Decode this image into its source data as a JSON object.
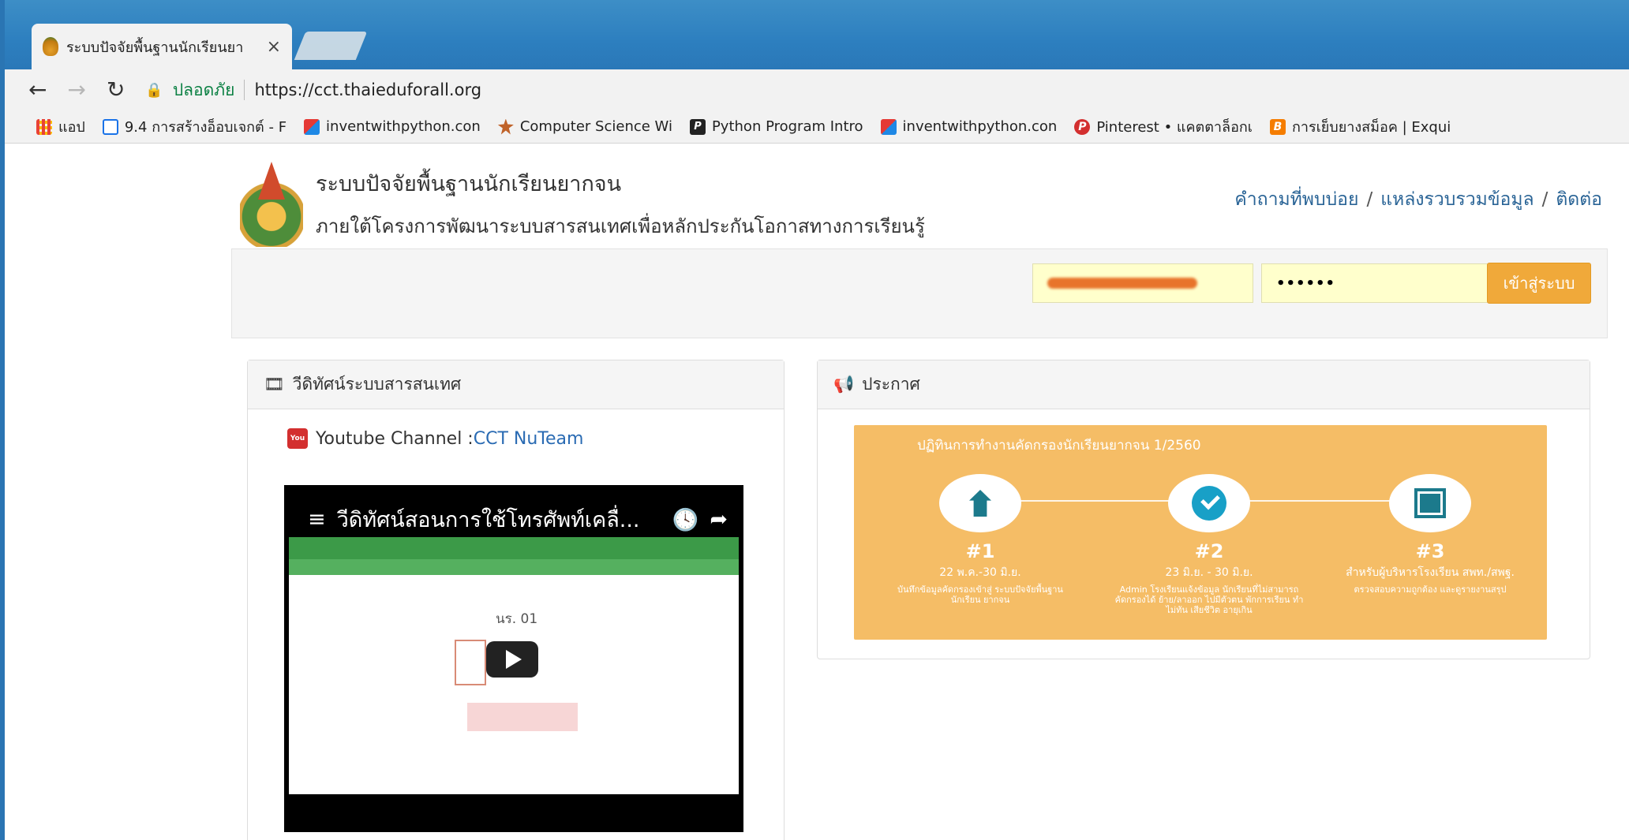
{
  "browser": {
    "tab_title": "ระบบปัจจัยพื้นฐานนักเรียนยา",
    "tab_close": "×",
    "secure_label": "ปลอดภัย",
    "url": "https://cct.thaieduforall.org",
    "bookmarks": [
      {
        "icon": "apps-icon",
        "label": "แอป"
      },
      {
        "icon": "page-icon",
        "label": "9.4 การสร้างอ็อบเจกต์ - F"
      },
      {
        "icon": "inventwithpython-icon",
        "label": "inventwithpython.con"
      },
      {
        "icon": "leaf-icon",
        "label": "Computer Science Wi"
      },
      {
        "icon": "python-icon",
        "label": "Python Program Intro"
      },
      {
        "icon": "inventwithpython-icon",
        "label": "inventwithpython.con"
      },
      {
        "icon": "pinterest-icon",
        "label": "Pinterest • แคตตาล็อกเ"
      },
      {
        "icon": "blogger-icon",
        "label": "การเย็บยางสม็อค | Exqui"
      }
    ]
  },
  "header": {
    "title": "ระบบปัจจัยพื้นฐานนักเรียนยากจน",
    "subtitle": "ภายใต้โครงการพัฒนาระบบสารสนเทศเพื่อหลักประกันโอกาสทางการเรียนรู้",
    "nav": [
      "คำถามที่พบบ่อย",
      "แหล่งรวบรวมข้อมูล",
      "ติดต่อ"
    ],
    "nav_sep": "/"
  },
  "login": {
    "password_value": "••••••",
    "button_label": "เข้าสู่ระบบ"
  },
  "video_panel": {
    "heading": "วีดิทัศน์ระบบสารสนเทศ",
    "channel_prefix": "Youtube Channel :",
    "channel_link": "CCT NuTeam",
    "video_title": "วีดิทัศน์สอนการใช้โทรศัพท์เคลื่...",
    "screen_label": "นร. 01"
  },
  "announce_panel": {
    "heading": "ประกาศ",
    "banner_title": "ปฏิทินการทำงานคัดกรองนักเรียนยากจน 1/2560",
    "steps": [
      {
        "num": "#1",
        "date": "22 พ.ค.-30 มิ.ย.",
        "desc": "บันทึกข้อมูลคัดกรองเข้าสู่ ระบบปัจจัยพื้นฐานนักเรียน ยากจน"
      },
      {
        "num": "#2",
        "date": "23 มิ.ย. - 30 มิ.ย.",
        "desc": "Admin โรงเรียนแจ้งข้อมูล นักเรียนที่ไม่สามารถคัดกรองได้ ย้าย/ลาออก ไปมีตัวตน พักการเรียน ทำไม่ทัน เสียชีวิต อายุเกิน"
      },
      {
        "num": "#3",
        "date": "สำหรับผู้บริหารโรงเรียน สพท./สพฐ.",
        "desc": "ตรวจสอบความถูกต้อง และดูรายงานสรุป"
      }
    ]
  },
  "colors": {
    "accent_orange": "#f0a93a",
    "link_blue": "#2a6496",
    "banner": "#f5bd66"
  }
}
